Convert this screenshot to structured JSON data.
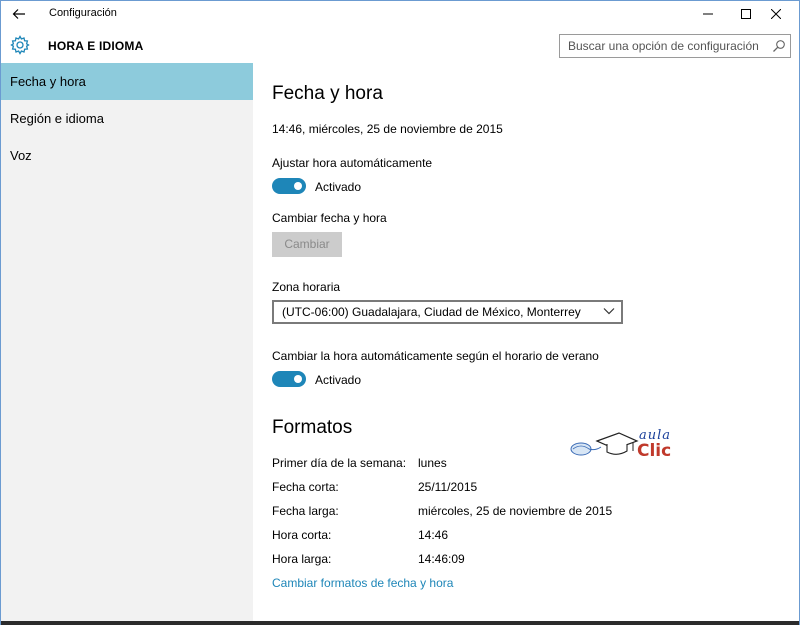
{
  "window": {
    "title": "Configuración",
    "icons": [
      "back-arrow-icon",
      "minimize-icon",
      "maximize-icon",
      "close-icon"
    ]
  },
  "header": {
    "title": "HORA E IDIOMA",
    "icon": "gear-icon",
    "search_placeholder": "Buscar una opción de configuración"
  },
  "sidebar": {
    "items": [
      {
        "label": "Fecha y hora",
        "active": true
      },
      {
        "label": "Región e idioma",
        "active": false
      },
      {
        "label": "Voz",
        "active": false
      }
    ]
  },
  "main": {
    "title": "Fecha y hora",
    "current_datetime": "14:46, miércoles, 25 de noviembre de 2015",
    "auto_time": {
      "label": "Ajustar hora automáticamente",
      "state": "Activado",
      "on": true
    },
    "change_datetime": {
      "label": "Cambiar fecha y hora",
      "button": "Cambiar",
      "disabled": true
    },
    "timezone": {
      "label": "Zona horaria",
      "value": "(UTC-06:00) Guadalajara, Ciudad de México, Monterrey"
    },
    "dst": {
      "label": "Cambiar la hora automáticamente según el horario de verano",
      "state": "Activado",
      "on": true
    },
    "formats": {
      "title": "Formatos",
      "rows": [
        {
          "label": "Primer día de la semana:",
          "value": "lunes"
        },
        {
          "label": "Fecha corta:",
          "value": "25/11/2015"
        },
        {
          "label": "Fecha larga:",
          "value": "miércoles, 25 de noviembre de 2015"
        },
        {
          "label": "Hora corta:",
          "value": "14:46"
        },
        {
          "label": "Hora larga:",
          "value": "14:46:09"
        }
      ],
      "link": "Cambiar formatos de fecha y hora"
    }
  },
  "watermark": {
    "line1": "aula",
    "line2": "Clic"
  },
  "colors": {
    "accent": "#1e86b8",
    "sidebar_active": "#8dcbdc",
    "sidebar_bg": "#f2f2f2"
  }
}
